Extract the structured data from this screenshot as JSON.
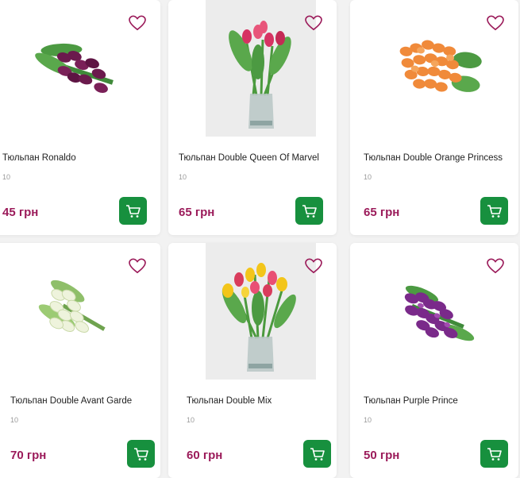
{
  "products": [
    {
      "name": "Тюльпан Ronaldo",
      "qty": "10",
      "price": "45 грн",
      "icon": "cart-icon",
      "flower_color": "#6b1a4d",
      "accent": "#8a2b66"
    },
    {
      "name": "Тюльпан Double Queen Of Marvel",
      "qty": "10",
      "price": "65 грн",
      "icon": "cart-icon",
      "flower_color": "#d63362",
      "accent": "#e8557a"
    },
    {
      "name": "Тюльпан Double Orange Princess",
      "qty": "10",
      "price": "65 грн",
      "icon": "cart-icon",
      "flower_color": "#f08a3a",
      "accent": "#f5a55c"
    },
    {
      "name": "Тюльпан Double Avant Garde",
      "qty": "10",
      "price": "70 грн",
      "icon": "cart-icon",
      "flower_color": "#eef3dc",
      "accent": "#d8e7b8"
    },
    {
      "name": "Тюльпан Double Mix",
      "qty": "10",
      "price": "60 грн",
      "icon": "cart-icon",
      "flower_color": "#f3c51a",
      "accent": "#d93c5c"
    },
    {
      "name": "Тюльпан Purple Prince",
      "qty": "10",
      "price": "50 грн",
      "icon": "cart-icon",
      "flower_color": "#7a2a8a",
      "accent": "#a34bb0"
    }
  ],
  "colors": {
    "price": "#9b1b5a",
    "cart": "#17903e",
    "favorite": "#9b1b5a"
  }
}
